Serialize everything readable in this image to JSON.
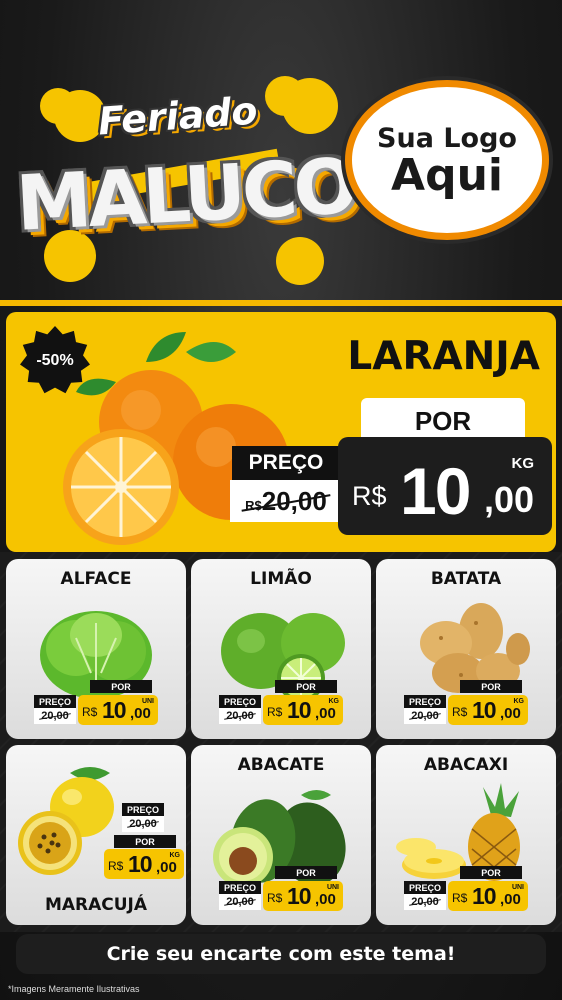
{
  "header": {
    "title_top": "Feriado",
    "title_main": "MALUCO",
    "logo_line1": "Sua Logo",
    "logo_line2": "Aqui",
    "accent": "#f6c400"
  },
  "featured": {
    "discount": "-50%",
    "name": "LARANJA",
    "por_label": "POR",
    "preco_label": "PREÇO",
    "old_currency": "R$",
    "old_price": "20,00",
    "unit": "KG",
    "currency": "R$",
    "price_int": "10",
    "price_dec": ",00"
  },
  "products": [
    {
      "name": "ALFACE",
      "preco_label": "PREÇO",
      "old_price": "20,00",
      "por_label": "POR",
      "currency": "R$",
      "price_int": "10",
      "price_dec": ",00",
      "unit": "UNI"
    },
    {
      "name": "LIMÃO",
      "preco_label": "PREÇO",
      "old_price": "20,00",
      "por_label": "POR",
      "currency": "R$",
      "price_int": "10",
      "price_dec": ",00",
      "unit": "KG"
    },
    {
      "name": "BATATA",
      "preco_label": "PREÇO",
      "old_price": "20,00",
      "por_label": "POR",
      "currency": "R$",
      "price_int": "10",
      "price_dec": ",00",
      "unit": "KG"
    },
    {
      "name": "MARACUJÁ",
      "preco_label": "PREÇO",
      "old_price": "20,00",
      "por_label": "POR",
      "currency": "R$",
      "price_int": "10",
      "price_dec": ",00",
      "unit": "KG"
    },
    {
      "name": "ABACATE",
      "preco_label": "PREÇO",
      "old_price": "20,00",
      "por_label": "POR",
      "currency": "R$",
      "price_int": "10",
      "price_dec": ",00",
      "unit": "UNI"
    },
    {
      "name": "ABACAXI",
      "preco_label": "PREÇO",
      "old_price": "20,00",
      "por_label": "POR",
      "currency": "R$",
      "price_int": "10",
      "price_dec": ",00",
      "unit": "UNI"
    }
  ],
  "footer": {
    "cta": "Crie seu encarte com este tema!",
    "disclaimer": "*Imagens Meramente Ilustrativas"
  }
}
